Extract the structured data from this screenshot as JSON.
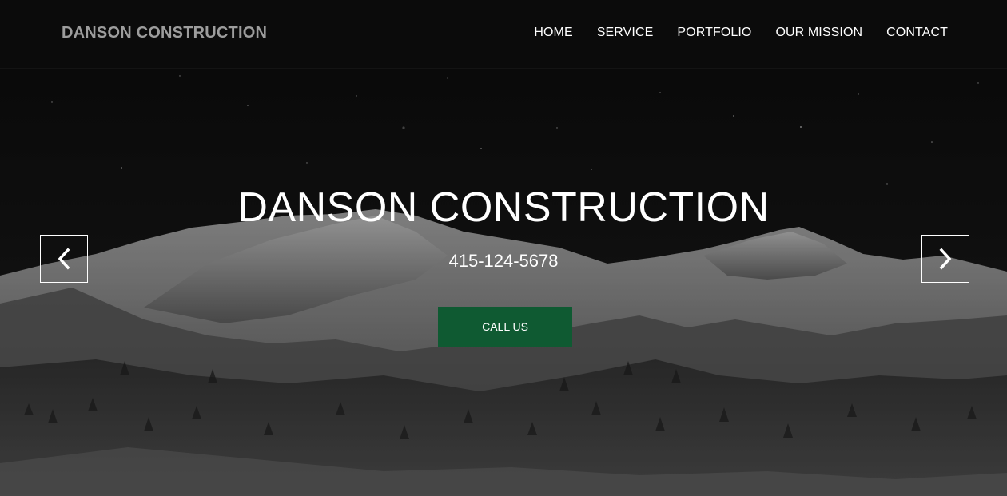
{
  "header": {
    "brand": "DANSON CONSTRUCTION",
    "nav": [
      "HOME",
      "SERVICE",
      "PORTFOLIO",
      "OUR MISSION",
      "CONTACT"
    ]
  },
  "hero": {
    "title": "DANSON CONSTRUCTION",
    "phone": "415-124-5678",
    "cta_label": "CALL US",
    "prev_icon": "chevron-left-icon",
    "next_icon": "chevron-right-icon",
    "background": "night mountain landscape"
  },
  "colors": {
    "cta_green": "#0f5a32",
    "brand_gray": "#9d9d9d",
    "navbar_bg": "#0c0c0c"
  }
}
